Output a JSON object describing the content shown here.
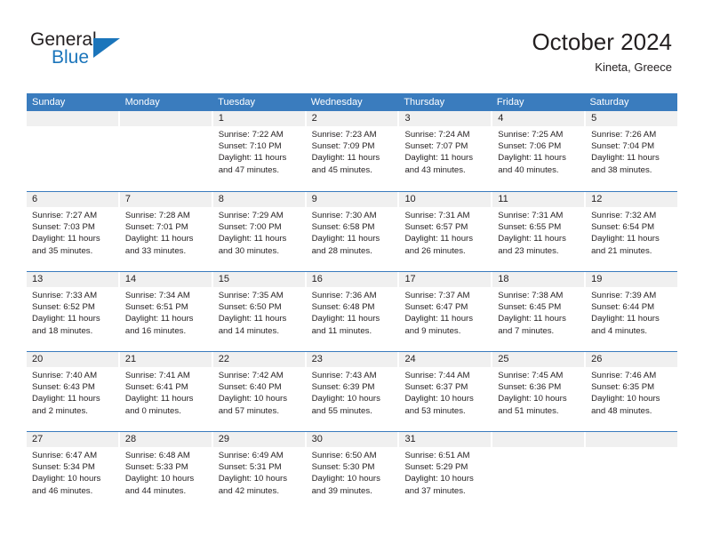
{
  "brand": {
    "name_top": "General",
    "name_bottom": "Blue",
    "accent_color": "#1b75bb"
  },
  "header": {
    "title": "October 2024",
    "subtitle": "Kineta, Greece"
  },
  "theme": {
    "header_row_bg": "#3a7cbe",
    "daynum_bg": "#f0f0f0",
    "text_color": "#231f20",
    "row_separator": "#3a7cbe"
  },
  "calendar": {
    "weekday_headers": [
      "Sunday",
      "Monday",
      "Tuesday",
      "Wednesday",
      "Thursday",
      "Friday",
      "Saturday"
    ],
    "weeks": [
      [
        {
          "day": "",
          "lines": []
        },
        {
          "day": "",
          "lines": []
        },
        {
          "day": "1",
          "lines": [
            "Sunrise: 7:22 AM",
            "Sunset: 7:10 PM",
            "Daylight: 11 hours",
            "and 47 minutes."
          ]
        },
        {
          "day": "2",
          "lines": [
            "Sunrise: 7:23 AM",
            "Sunset: 7:09 PM",
            "Daylight: 11 hours",
            "and 45 minutes."
          ]
        },
        {
          "day": "3",
          "lines": [
            "Sunrise: 7:24 AM",
            "Sunset: 7:07 PM",
            "Daylight: 11 hours",
            "and 43 minutes."
          ]
        },
        {
          "day": "4",
          "lines": [
            "Sunrise: 7:25 AM",
            "Sunset: 7:06 PM",
            "Daylight: 11 hours",
            "and 40 minutes."
          ]
        },
        {
          "day": "5",
          "lines": [
            "Sunrise: 7:26 AM",
            "Sunset: 7:04 PM",
            "Daylight: 11 hours",
            "and 38 minutes."
          ]
        }
      ],
      [
        {
          "day": "6",
          "lines": [
            "Sunrise: 7:27 AM",
            "Sunset: 7:03 PM",
            "Daylight: 11 hours",
            "and 35 minutes."
          ]
        },
        {
          "day": "7",
          "lines": [
            "Sunrise: 7:28 AM",
            "Sunset: 7:01 PM",
            "Daylight: 11 hours",
            "and 33 minutes."
          ]
        },
        {
          "day": "8",
          "lines": [
            "Sunrise: 7:29 AM",
            "Sunset: 7:00 PM",
            "Daylight: 11 hours",
            "and 30 minutes."
          ]
        },
        {
          "day": "9",
          "lines": [
            "Sunrise: 7:30 AM",
            "Sunset: 6:58 PM",
            "Daylight: 11 hours",
            "and 28 minutes."
          ]
        },
        {
          "day": "10",
          "lines": [
            "Sunrise: 7:31 AM",
            "Sunset: 6:57 PM",
            "Daylight: 11 hours",
            "and 26 minutes."
          ]
        },
        {
          "day": "11",
          "lines": [
            "Sunrise: 7:31 AM",
            "Sunset: 6:55 PM",
            "Daylight: 11 hours",
            "and 23 minutes."
          ]
        },
        {
          "day": "12",
          "lines": [
            "Sunrise: 7:32 AM",
            "Sunset: 6:54 PM",
            "Daylight: 11 hours",
            "and 21 minutes."
          ]
        }
      ],
      [
        {
          "day": "13",
          "lines": [
            "Sunrise: 7:33 AM",
            "Sunset: 6:52 PM",
            "Daylight: 11 hours",
            "and 18 minutes."
          ]
        },
        {
          "day": "14",
          "lines": [
            "Sunrise: 7:34 AM",
            "Sunset: 6:51 PM",
            "Daylight: 11 hours",
            "and 16 minutes."
          ]
        },
        {
          "day": "15",
          "lines": [
            "Sunrise: 7:35 AM",
            "Sunset: 6:50 PM",
            "Daylight: 11 hours",
            "and 14 minutes."
          ]
        },
        {
          "day": "16",
          "lines": [
            "Sunrise: 7:36 AM",
            "Sunset: 6:48 PM",
            "Daylight: 11 hours",
            "and 11 minutes."
          ]
        },
        {
          "day": "17",
          "lines": [
            "Sunrise: 7:37 AM",
            "Sunset: 6:47 PM",
            "Daylight: 11 hours",
            "and 9 minutes."
          ]
        },
        {
          "day": "18",
          "lines": [
            "Sunrise: 7:38 AM",
            "Sunset: 6:45 PM",
            "Daylight: 11 hours",
            "and 7 minutes."
          ]
        },
        {
          "day": "19",
          "lines": [
            "Sunrise: 7:39 AM",
            "Sunset: 6:44 PM",
            "Daylight: 11 hours",
            "and 4 minutes."
          ]
        }
      ],
      [
        {
          "day": "20",
          "lines": [
            "Sunrise: 7:40 AM",
            "Sunset: 6:43 PM",
            "Daylight: 11 hours",
            "and 2 minutes."
          ]
        },
        {
          "day": "21",
          "lines": [
            "Sunrise: 7:41 AM",
            "Sunset: 6:41 PM",
            "Daylight: 11 hours",
            "and 0 minutes."
          ]
        },
        {
          "day": "22",
          "lines": [
            "Sunrise: 7:42 AM",
            "Sunset: 6:40 PM",
            "Daylight: 10 hours",
            "and 57 minutes."
          ]
        },
        {
          "day": "23",
          "lines": [
            "Sunrise: 7:43 AM",
            "Sunset: 6:39 PM",
            "Daylight: 10 hours",
            "and 55 minutes."
          ]
        },
        {
          "day": "24",
          "lines": [
            "Sunrise: 7:44 AM",
            "Sunset: 6:37 PM",
            "Daylight: 10 hours",
            "and 53 minutes."
          ]
        },
        {
          "day": "25",
          "lines": [
            "Sunrise: 7:45 AM",
            "Sunset: 6:36 PM",
            "Daylight: 10 hours",
            "and 51 minutes."
          ]
        },
        {
          "day": "26",
          "lines": [
            "Sunrise: 7:46 AM",
            "Sunset: 6:35 PM",
            "Daylight: 10 hours",
            "and 48 minutes."
          ]
        }
      ],
      [
        {
          "day": "27",
          "lines": [
            "Sunrise: 6:47 AM",
            "Sunset: 5:34 PM",
            "Daylight: 10 hours",
            "and 46 minutes."
          ]
        },
        {
          "day": "28",
          "lines": [
            "Sunrise: 6:48 AM",
            "Sunset: 5:33 PM",
            "Daylight: 10 hours",
            "and 44 minutes."
          ]
        },
        {
          "day": "29",
          "lines": [
            "Sunrise: 6:49 AM",
            "Sunset: 5:31 PM",
            "Daylight: 10 hours",
            "and 42 minutes."
          ]
        },
        {
          "day": "30",
          "lines": [
            "Sunrise: 6:50 AM",
            "Sunset: 5:30 PM",
            "Daylight: 10 hours",
            "and 39 minutes."
          ]
        },
        {
          "day": "31",
          "lines": [
            "Sunrise: 6:51 AM",
            "Sunset: 5:29 PM",
            "Daylight: 10 hours",
            "and 37 minutes."
          ]
        },
        {
          "day": "",
          "lines": []
        },
        {
          "day": "",
          "lines": []
        }
      ]
    ]
  }
}
